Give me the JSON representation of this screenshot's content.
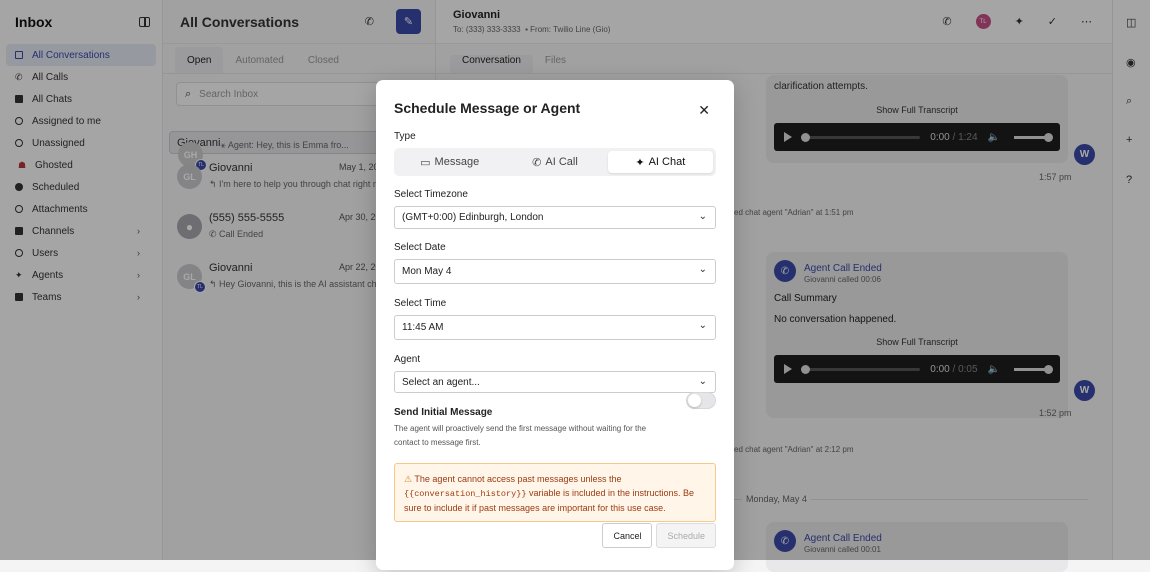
{
  "sidebar": {
    "title": "Inbox",
    "items": [
      {
        "label": "All Conversations",
        "icon": "inbox-icon"
      },
      {
        "label": "All Calls",
        "icon": "phone-icon"
      },
      {
        "label": "All Chats",
        "icon": "chat-icon"
      },
      {
        "label": "Assigned to me",
        "icon": "user-icon"
      },
      {
        "label": "Unassigned",
        "icon": "user-minus-icon"
      },
      {
        "label": "Ghosted",
        "icon": "ghost-icon"
      },
      {
        "label": "Scheduled",
        "icon": "clock-icon"
      },
      {
        "label": "Attachments",
        "icon": "paperclip-icon"
      },
      {
        "label": "Channels",
        "icon": "channels-icon"
      },
      {
        "label": "Users",
        "icon": "users-icon"
      },
      {
        "label": "Agents",
        "icon": "sparkle-icon"
      },
      {
        "label": "Teams",
        "icon": "folder-icon"
      }
    ]
  },
  "list": {
    "title": "All Conversations",
    "tabs": [
      "Open",
      "Automated",
      "Closed"
    ],
    "search_placeholder": "Search Inbox",
    "conversations": [
      {
        "initials": "GH",
        "name": "Giovanni",
        "date": "",
        "preview": "Agent: Hey, this is Emma fro...",
        "badge": "TL"
      },
      {
        "initials": "GL",
        "name": "Giovanni",
        "date": "May 1, 2025",
        "preview": "I'm here to help you through chat right now...",
        "badge": ""
      },
      {
        "initials": "",
        "name": "(555) 555-5555",
        "date": "Apr 30, 2025",
        "preview": "Call Ended",
        "badge": ""
      },
      {
        "initials": "GL",
        "name": "Giovanni",
        "date": "Apr 22, 2025",
        "preview": "Hey Giovanni, this is the AI assistant checking...",
        "badge": "TL"
      }
    ]
  },
  "chat": {
    "name": "Giovanni",
    "to": "To: (333) 333-3333",
    "from": "From: Twilio Line (Gio)",
    "avatar": "TL",
    "tabs": [
      "Conversation",
      "Files"
    ],
    "top_text": "clarification attempts.",
    "show_full": "Show Full Transcript",
    "audio1": {
      "current": "0:00",
      "sep": "/",
      "total": "1:24"
    },
    "time1": "1:57 pm",
    "sys1": "ed chat agent \"Adrian\" at 1:51 pm",
    "call_title": "Agent Call Ended",
    "call_sub": "Giovanni called 00:06",
    "call_summary": "Call Summary",
    "call_text": "No conversation happened.",
    "audio2": {
      "current": "0:00",
      "sep": "/",
      "total": "0:05"
    },
    "time2": "1:52 pm",
    "sys2": "ed chat agent \"Adrian\" at 2:12 pm",
    "date_divider": "Monday, May 4",
    "call2_title": "Agent Call Ended",
    "call2_sub": "Giovanni called 00:01"
  },
  "modal": {
    "title": "Schedule Message or Agent",
    "type_label": "Type",
    "types": [
      "Message",
      "AI Call",
      "AI Chat"
    ],
    "selected_type": "AI Chat",
    "timezone_label": "Select Timezone",
    "timezone_value": "(GMT+0:00) Edinburgh, London",
    "date_label": "Select Date",
    "date_value": "Mon May 4",
    "time_label": "Select Time",
    "time_value": "11:45 AM",
    "agent_label": "Agent",
    "agent_placeholder": "Select an agent...",
    "initial_label": "Send Initial Message",
    "initial_help": "The agent will proactively send the first message without waiting for the contact to message first.",
    "initial_enabled": false,
    "warning_pre": "The agent cannot access past messages unless the",
    "warning_code": "{{conversation_history}}",
    "warning_post": "variable is included in the instructions. Be sure to include it if past messages are important for this use case.",
    "cancel": "Cancel",
    "schedule": "Schedule"
  },
  "colors": {
    "accent": "#3b4aa8",
    "warning_bg": "#fff6e9",
    "warning_text": "#9b3a12"
  }
}
